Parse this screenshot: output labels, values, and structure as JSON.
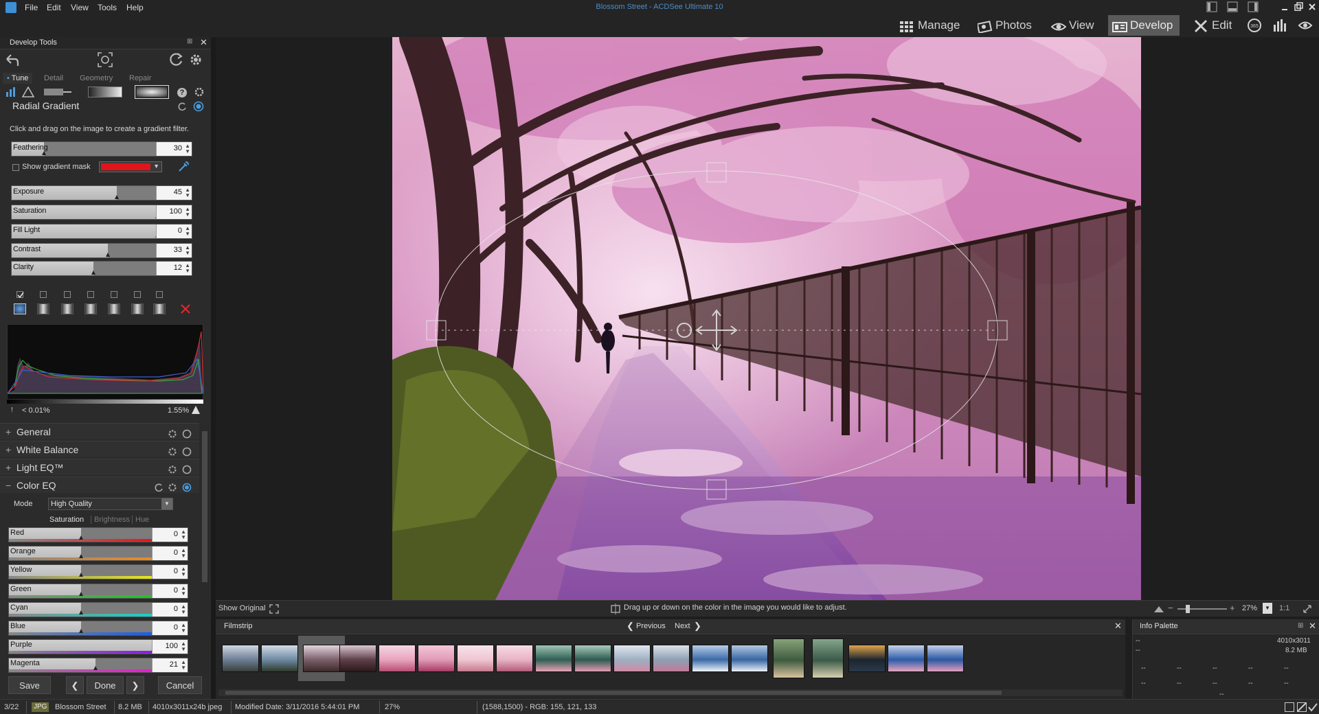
{
  "titlebar": {
    "title": "Blossom Street - ACDSee Ultimate 10",
    "menu": [
      "File",
      "Edit",
      "View",
      "Tools",
      "Help"
    ],
    "modes": [
      {
        "label": "Manage",
        "icon": "grid-icon"
      },
      {
        "label": "Photos",
        "icon": "photos-icon"
      },
      {
        "label": "View",
        "icon": "eye-icon"
      },
      {
        "label": "Develop",
        "icon": "develop-icon",
        "active": true
      },
      {
        "label": "Edit",
        "icon": "edit-icon"
      }
    ]
  },
  "develop_tools": {
    "panel_title": "Develop Tools",
    "tabs": [
      "Tune",
      "Detail",
      "Geometry",
      "Repair"
    ],
    "tool_name": "Radial Gradient",
    "instruction": "Click and drag on the image to create a gradient filter.",
    "feathering": {
      "label": "Feathering",
      "value": "30",
      "fraction": 0.22
    },
    "show_mask_label": "Show gradient mask",
    "mask_color": "#e0141c",
    "sliders": [
      {
        "label": "Exposure",
        "value": "45",
        "fraction": 0.72
      },
      {
        "label": "Saturation",
        "value": "100",
        "fraction": 1.0
      },
      {
        "label": "Fill Light",
        "value": "0",
        "fraction": 1.0
      },
      {
        "label": "Contrast",
        "value": "33",
        "fraction": 0.66
      },
      {
        "label": "Clarity",
        "value": "12",
        "fraction": 0.56
      }
    ],
    "histogram": {
      "low_clip": "< 0.01%",
      "high_clip": "1.55%"
    },
    "sections": [
      {
        "label": "General",
        "sign": "+"
      },
      {
        "label": "White Balance",
        "sign": "+"
      },
      {
        "label": "Light EQ™",
        "sign": "+"
      },
      {
        "label": "Color EQ",
        "sign": "−"
      }
    ],
    "color_eq": {
      "mode_label": "Mode",
      "mode_value": "High Quality",
      "subtabs": [
        "Saturation",
        "Brightness",
        "Hue"
      ],
      "channels": [
        {
          "label": "Red",
          "value": "0",
          "fraction": 0.5,
          "color": "#e8151b"
        },
        {
          "label": "Orange",
          "value": "0",
          "fraction": 0.5,
          "color": "#f08a1c"
        },
        {
          "label": "Yellow",
          "value": "0",
          "fraction": 0.5,
          "color": "#e8e61a"
        },
        {
          "label": "Green",
          "value": "0",
          "fraction": 0.5,
          "color": "#19c81f"
        },
        {
          "label": "Cyan",
          "value": "0",
          "fraction": 0.5,
          "color": "#1ad0c8"
        },
        {
          "label": "Blue",
          "value": "0",
          "fraction": 0.5,
          "color": "#1a5de8"
        },
        {
          "label": "Purple",
          "value": "100",
          "fraction": 1.0,
          "color": "#8a1ae8"
        },
        {
          "label": "Magenta",
          "value": "21",
          "fraction": 0.6,
          "color": "#e81ad0"
        }
      ]
    },
    "buttons": {
      "save": "Save",
      "done": "Done",
      "cancel": "Cancel"
    }
  },
  "viewer": {
    "show_original": "Show Original",
    "hint": "Drag up or down on the color in the image you would like to adjust.",
    "zoom": "27%",
    "ratio": "1:1"
  },
  "filmstrip": {
    "title": "Filmstrip",
    "previous": "Previous",
    "next": "Next",
    "thumb_count": 19,
    "selected_index": 2
  },
  "info_palette": {
    "title": "Info Palette",
    "dims": "4010x3011",
    "size": "8.2 MB",
    "empty": "--"
  },
  "status": {
    "index": "3/22",
    "format": "JPG",
    "filename": "Blossom Street",
    "filesize": "8.2 MB",
    "dims": "4010x3011x24b jpeg",
    "modified": "Modified Date: 3/11/2016 5:44:01 PM",
    "zoom": "27%",
    "pixel": "(1588,1500) - RGB: 155, 121, 133"
  }
}
